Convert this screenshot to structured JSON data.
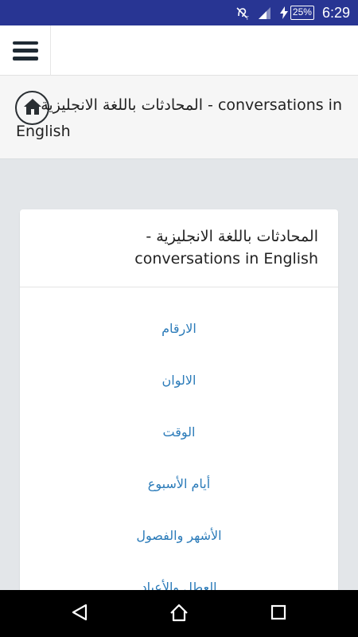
{
  "status_bar": {
    "battery_level": "25%",
    "time": "6:29",
    "colors": {
      "background": "#283593"
    },
    "icons": [
      "hearing-aid-off-icon",
      "signal-icon",
      "charging-bolt-icon",
      "battery-icon"
    ]
  },
  "app_bar": {
    "menu_icon": "hamburger-menu-icon"
  },
  "breadcrumb": {
    "home_icon": "home-icon",
    "title_line1": "conversations in - المحادثات باللغة الانجليزية",
    "title_line2": "English"
  },
  "card": {
    "title_line1": "المحادثات باللغة الانجليزية -",
    "title_line2": "conversations in English",
    "items": [
      {
        "label": "الارقام"
      },
      {
        "label": "الالوان"
      },
      {
        "label": "الوقت"
      },
      {
        "label": "أيام الأسبوع"
      },
      {
        "label": "الأشهر والفصول"
      },
      {
        "label": "العطل والأعياد"
      }
    ],
    "link_color": "#2b7bb9"
  },
  "nav_bar": {
    "back_icon": "back-triangle-icon",
    "home_icon": "home-circle-icon",
    "recents_icon": "recents-square-icon"
  }
}
